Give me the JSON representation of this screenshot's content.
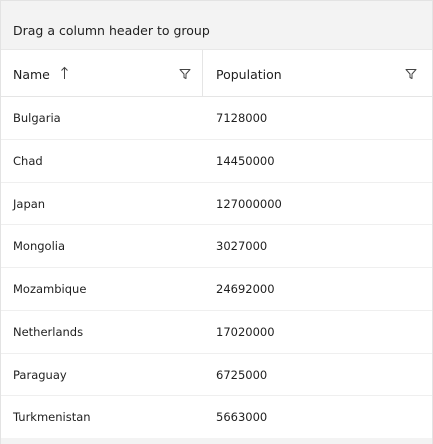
{
  "group_panel": {
    "hint": "Drag a column header to group"
  },
  "columns": [
    {
      "label": "Name",
      "sort": "ascending",
      "icons": [
        "sort-ascending-icon",
        "filter-icon"
      ]
    },
    {
      "label": "Population",
      "icons": [
        "filter-icon"
      ]
    }
  ],
  "rows": [
    {
      "name": "Bulgaria",
      "population": "7128000"
    },
    {
      "name": "Chad",
      "population": "14450000"
    },
    {
      "name": "Japan",
      "population": "127000000"
    },
    {
      "name": "Mongolia",
      "population": "3027000"
    },
    {
      "name": "Mozambique",
      "population": "24692000"
    },
    {
      "name": "Netherlands",
      "population": "17020000"
    },
    {
      "name": "Paraguay",
      "population": "6725000"
    },
    {
      "name": "Turkmenistan",
      "population": "5663000"
    }
  ],
  "colors": {
    "group_panel_bg": "#f3f3f3",
    "border": "#e5e5e5",
    "text": "#1f1f1f"
  }
}
